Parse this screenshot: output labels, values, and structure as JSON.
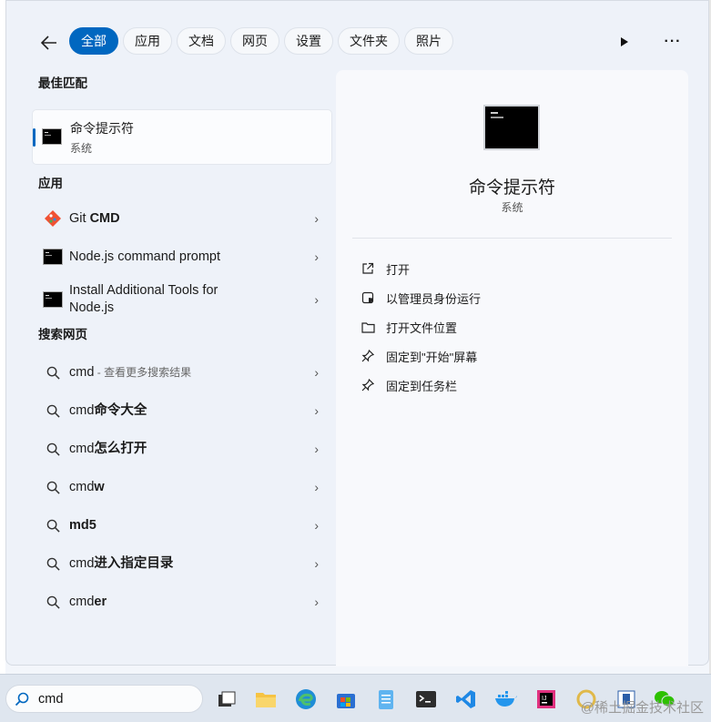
{
  "tabs": [
    "全部",
    "应用",
    "文档",
    "网页",
    "设置",
    "文件夹",
    "照片"
  ],
  "sections": {
    "best_match": "最佳匹配",
    "apps": "应用",
    "web": "搜索网页"
  },
  "best_match": {
    "name": "命令提示符",
    "sub": "系统"
  },
  "apps": [
    {
      "pre": "Git ",
      "bold": "CMD",
      "icon": "git-icon"
    },
    {
      "text": "Node.js command prompt",
      "icon": "terminal-icon"
    },
    {
      "line1": "Install Additional Tools for",
      "line2": "Node.js",
      "icon": "terminal-icon"
    }
  ],
  "web": [
    {
      "pre": "cmd",
      "bold": "",
      "suffix": " - 查看更多搜索结果"
    },
    {
      "pre": "cmd",
      "bold": "命令大全",
      "suffix": ""
    },
    {
      "pre": "cmd",
      "bold": "怎么打开",
      "suffix": ""
    },
    {
      "pre": "cmd",
      "bold": "w",
      "suffix": ""
    },
    {
      "pre": "",
      "bold": "md5",
      "suffix": ""
    },
    {
      "pre": "cmd",
      "bold": "进入指定目录",
      "suffix": ""
    },
    {
      "pre": "cmd",
      "bold": "er",
      "suffix": ""
    }
  ],
  "detail": {
    "title": "命令提示符",
    "sub": "系统",
    "actions": [
      {
        "label": "打开",
        "icon": "open-external-icon"
      },
      {
        "label": "以管理员身份运行",
        "icon": "shield-icon"
      },
      {
        "label": "打开文件位置",
        "icon": "folder-icon"
      },
      {
        "label": "固定到\"开始\"屏幕",
        "icon": "pin-icon"
      },
      {
        "label": "固定到任务栏",
        "icon": "pin-icon"
      }
    ]
  },
  "taskbar": {
    "search_value": "cmd",
    "watermark": "@稀土掘金技术社区"
  },
  "colors": {
    "accent": "#0067c0",
    "panel": "#eef2f9"
  }
}
